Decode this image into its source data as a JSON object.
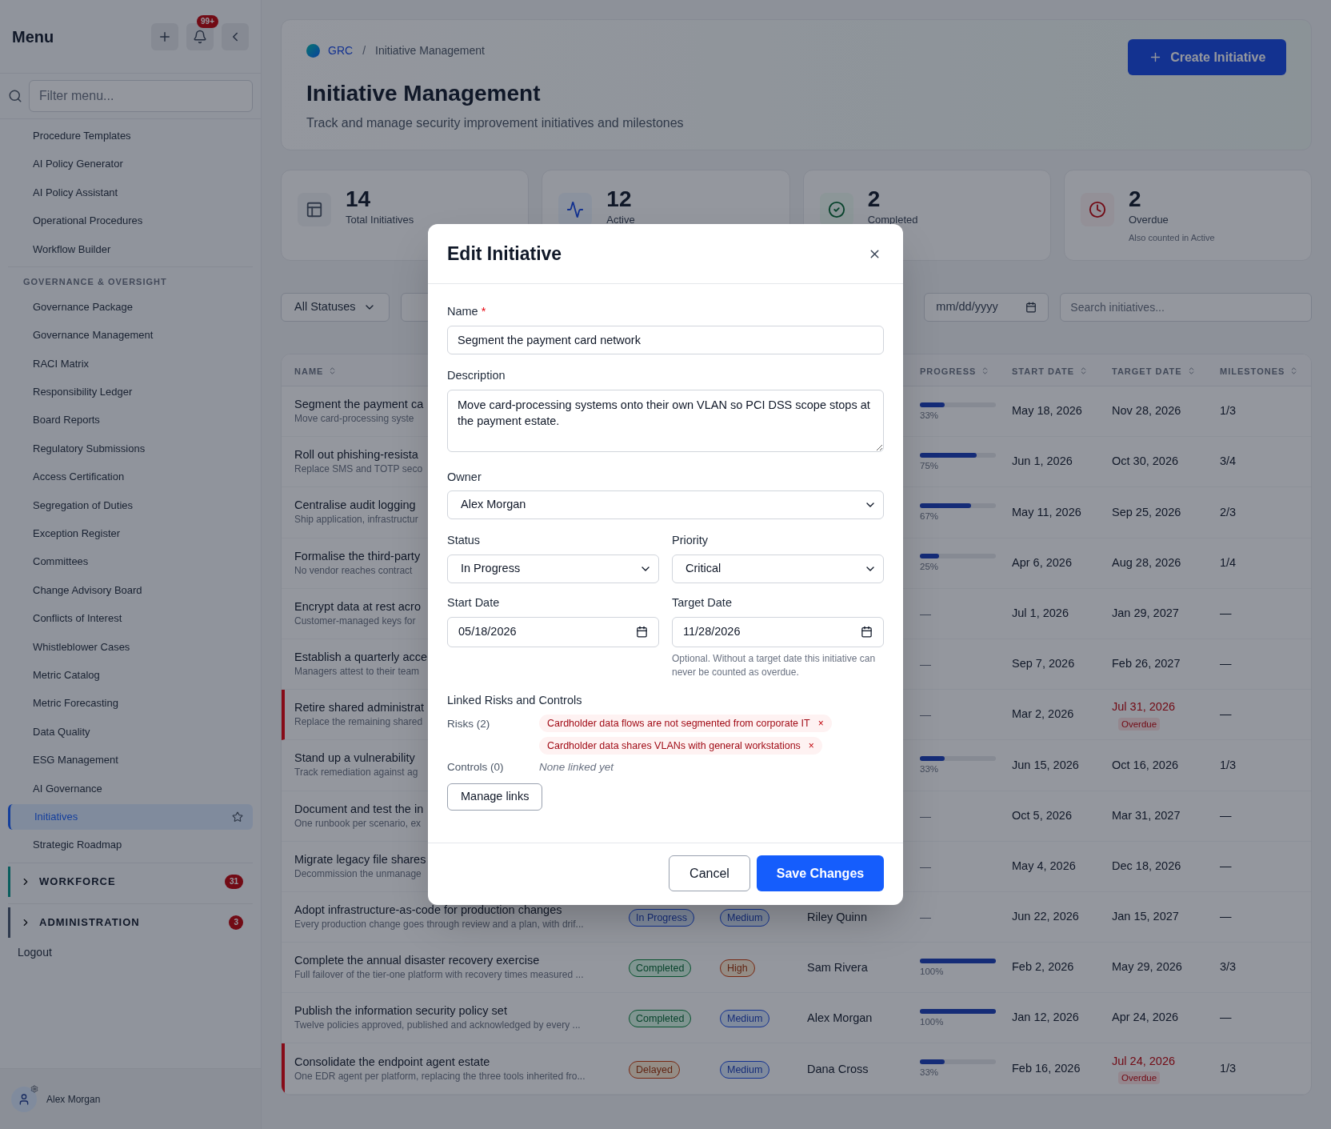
{
  "sidebar": {
    "title": "Menu",
    "notifications": "99+",
    "filter_placeholder": "Filter menu...",
    "sections": [
      {
        "items": [
          {
            "label": "Procedure Templates",
            "selected": false
          },
          {
            "label": "AI Policy Generator",
            "selected": false
          },
          {
            "label": "AI Policy Assistant",
            "selected": false
          },
          {
            "label": "Operational Procedures",
            "selected": false
          },
          {
            "label": "Workflow Builder",
            "selected": false
          }
        ]
      },
      {
        "heading": "GOVERNANCE & OVERSIGHT",
        "items": [
          {
            "label": "Governance Package",
            "selected": false
          },
          {
            "label": "Governance Management",
            "selected": false
          },
          {
            "label": "RACI Matrix",
            "selected": false
          },
          {
            "label": "Responsibility Ledger",
            "selected": false
          },
          {
            "label": "Board Reports",
            "selected": false
          },
          {
            "label": "Regulatory Submissions",
            "selected": false
          },
          {
            "label": "Access Certification",
            "selected": false
          },
          {
            "label": "Segregation of Duties",
            "selected": false
          },
          {
            "label": "Exception Register",
            "selected": false
          },
          {
            "label": "Committees",
            "selected": false
          },
          {
            "label": "Change Advisory Board",
            "selected": false
          },
          {
            "label": "Conflicts of Interest",
            "selected": false
          },
          {
            "label": "Whistleblower Cases",
            "selected": false
          },
          {
            "label": "Metric Catalog",
            "selected": false
          },
          {
            "label": "Metric Forecasting",
            "selected": false
          },
          {
            "label": "Data Quality",
            "selected": false
          },
          {
            "label": "ESG Management",
            "selected": false
          },
          {
            "label": "AI Governance",
            "selected": false
          },
          {
            "label": "Initiatives",
            "selected": true
          },
          {
            "label": "Strategic Roadmap",
            "selected": false
          }
        ]
      }
    ],
    "groups": [
      {
        "label": "WORKFORCE",
        "badge": "31",
        "kind": "teal",
        "expanded": false
      },
      {
        "label": "ADMINISTRATION",
        "badge": "3",
        "kind": "slate",
        "expanded": false
      }
    ],
    "logout": "Logout",
    "user": "Alex Morgan"
  },
  "header": {
    "breadcrumb": [
      "GRC",
      "Initiative Management"
    ],
    "separator": "/",
    "title": "Initiative Management",
    "subtitle": "Track and manage security improvement initiatives and milestones",
    "action": "Create Initiative"
  },
  "stats": [
    {
      "kind": "total",
      "value": "14",
      "label": "Total Initiatives"
    },
    {
      "kind": "active",
      "value": "12",
      "label": "Active"
    },
    {
      "kind": "completed",
      "value": "2",
      "label": "Completed"
    },
    {
      "kind": "overdue",
      "value": "2",
      "label": "Overdue",
      "note": "Also counted in Active"
    }
  ],
  "filters": {
    "status": "All Statuses",
    "date_placeholder": "mm/dd/yyyy",
    "search_placeholder": "Search initiatives..."
  },
  "table": {
    "columns": [
      "NAME",
      "PROGRESS",
      "START DATE",
      "TARGET DATE",
      "MILESTONES"
    ],
    "rows": [
      {
        "name": "Segment the payment ca",
        "description": "Move card-processing syste",
        "progress": {
          "kind": "bar",
          "level": 0.33,
          "reading": "33%"
        },
        "start": "May 18, 2026",
        "target": {
          "date": "Nov 28, 2026",
          "overdue": false
        },
        "milestones": "1/3"
      },
      {
        "name": "Roll out phishing-resista",
        "description": "Replace SMS and TOTP seco",
        "progress": {
          "kind": "bar",
          "level": 0.75,
          "reading": "75%"
        },
        "start": "Jun 1, 2026",
        "target": {
          "date": "Oct 30, 2026",
          "overdue": false
        },
        "milestones": "3/4"
      },
      {
        "name": "Centralise audit logging",
        "description": "Ship application, infrastructur",
        "progress": {
          "kind": "bar",
          "level": 0.67,
          "reading": "67%"
        },
        "start": "May 11, 2026",
        "target": {
          "date": "Sep 25, 2026",
          "overdue": false
        },
        "milestones": "2/3"
      },
      {
        "name": "Formalise the third-party",
        "description": "No vendor reaches contract",
        "progress": {
          "kind": "bar",
          "level": 0.25,
          "reading": "25%"
        },
        "start": "Apr 6, 2026",
        "target": {
          "date": "Aug 28, 2026",
          "overdue": false
        },
        "milestones": "1/4"
      },
      {
        "name": "Encrypt data at rest acro",
        "description": "Customer-managed keys for",
        "progress": {
          "kind": "none",
          "reading": "—"
        },
        "start": "Jul 1, 2026",
        "target": {
          "date": "Jan 29, 2027",
          "overdue": false
        },
        "milestones": "—"
      },
      {
        "name": "Establish a quarterly acce",
        "description": "Managers attest to their team",
        "progress": {
          "kind": "none",
          "reading": "—"
        },
        "start": "Sep 7, 2026",
        "target": {
          "date": "Feb 26, 2027",
          "overdue": false
        },
        "milestones": "—"
      },
      {
        "name": "Retire shared administrat",
        "description": "Replace the remaining shared",
        "progress": {
          "kind": "none",
          "reading": "—"
        },
        "start": "Mar 2, 2026",
        "target": {
          "date": "Jul 31, 2026",
          "overdue": true,
          "badge": "Overdue"
        },
        "milestones": "—"
      },
      {
        "name": "Stand up a vulnerability",
        "description": "Track remediation against ag",
        "progress": {
          "kind": "bar",
          "level": 0.33,
          "reading": "33%"
        },
        "start": "Jun 15, 2026",
        "target": {
          "date": "Oct 16, 2026",
          "overdue": false
        },
        "milestones": "1/3"
      },
      {
        "name": "Document and test the in",
        "description": "One runbook per scenario, ex",
        "progress": {
          "kind": "none",
          "reading": "—"
        },
        "start": "Oct 5, 2026",
        "target": {
          "date": "Mar 31, 2027",
          "overdue": false
        },
        "milestones": "—"
      },
      {
        "name": "Migrate legacy file shares",
        "description": "Decommission the unmanage",
        "progress": {
          "kind": "none",
          "reading": "—"
        },
        "start": "May 4, 2026",
        "target": {
          "date": "Dec 18, 2026",
          "overdue": false
        },
        "milestones": "—"
      },
      {
        "name": "Adopt infrastructure-as-code for production changes",
        "description": "Every production change goes through review and a plan, with drif...",
        "status": {
          "label": "In Progress",
          "kind": "blue"
        },
        "priority": {
          "label": "Medium",
          "kind": "blue"
        },
        "owner": "Riley Quinn",
        "progress": {
          "kind": "none",
          "reading": "—"
        },
        "start": "Jun 22, 2026",
        "target": {
          "date": "Jan 15, 2027",
          "overdue": false
        },
        "milestones": "—"
      },
      {
        "name": "Complete the annual disaster recovery exercise",
        "description": "Full failover of the tier-one platform with recovery times measured ...",
        "status": {
          "label": "Completed",
          "kind": "green"
        },
        "priority": {
          "label": "High",
          "kind": "orange"
        },
        "owner": "Sam Rivera",
        "progress": {
          "kind": "bar",
          "level": 1,
          "reading": "100%"
        },
        "start": "Feb 2, 2026",
        "target": {
          "date": "May 29, 2026",
          "overdue": false
        },
        "milestones": "3/3"
      },
      {
        "name": "Publish the information security policy set",
        "description": "Twelve policies approved, published and acknowledged by every ...",
        "status": {
          "label": "Completed",
          "kind": "green"
        },
        "priority": {
          "label": "Medium",
          "kind": "blue"
        },
        "owner": "Alex Morgan",
        "progress": {
          "kind": "bar",
          "level": 1,
          "reading": "100%"
        },
        "start": "Jan 12, 2026",
        "target": {
          "date": "Apr 24, 2026",
          "overdue": false
        },
        "milestones": "—"
      },
      {
        "name": "Consolidate the endpoint agent estate",
        "description": "One EDR agent per platform, replacing the three tools inherited fro...",
        "status": {
          "label": "Delayed",
          "kind": "orange"
        },
        "priority": {
          "label": "Medium",
          "kind": "blue"
        },
        "owner": "Dana Cross",
        "progress": {
          "kind": "bar",
          "level": 0.33,
          "reading": "33%"
        },
        "start": "Feb 16, 2026",
        "target": {
          "date": "Jul 24, 2026",
          "overdue": true,
          "badge": "Overdue"
        },
        "milestones": "1/3"
      }
    ]
  },
  "modal": {
    "title": "Edit Initiative",
    "name": {
      "label": "Name",
      "required_mark": "*",
      "value": "Segment the payment card network"
    },
    "description": {
      "label": "Description",
      "value": "Move card-processing systems onto their own VLAN so PCI DSS scope stops at the payment estate."
    },
    "owner": {
      "label": "Owner",
      "value": "Alex Morgan"
    },
    "status": {
      "label": "Status",
      "value": "In Progress"
    },
    "priority": {
      "label": "Priority",
      "value": "Critical"
    },
    "start_date": {
      "label": "Start Date",
      "value": "05/18/2026"
    },
    "target_date": {
      "label": "Target Date",
      "value": "11/28/2026",
      "hint": "Optional. Without a target date this initiative can never be counted as overdue."
    },
    "links": {
      "heading": "Linked Risks and Controls",
      "risks_label": "Risks (2)",
      "risks": [
        "Cardholder data flows are not segmented from corporate IT",
        "Cardholder data shares VLANs with general workstations"
      ],
      "remove": "×",
      "controls_label": "Controls (0)",
      "controls_empty": "None linked yet",
      "manage": "Manage links"
    },
    "cancel": "Cancel",
    "save": "Save Changes"
  }
}
